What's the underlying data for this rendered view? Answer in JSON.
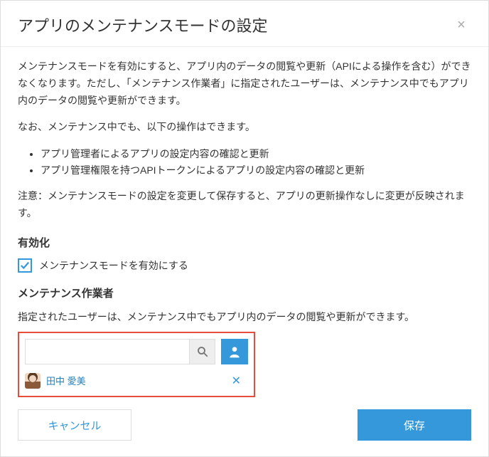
{
  "header": {
    "title": "アプリのメンテナンスモードの設定"
  },
  "body": {
    "para1": "メンテナンスモードを有効にすると、アプリ内のデータの閲覧や更新（APIによる操作を含む）ができなくなります。ただし、「メンテナンス作業者」に指定されたユーザーは、メンテナンス中でもアプリ内のデータの閲覧や更新ができます。",
    "para2": "なお、メンテナンス中でも、以下の操作はできます。",
    "bullets": [
      "アプリ管理者によるアプリの設定内容の確認と更新",
      "アプリ管理権限を持つAPIトークンによるアプリの設定内容の確認と更新"
    ],
    "para3": "注意：メンテナンスモードの設定を変更して保存すると、アプリの更新操作なしに変更が反映されます。"
  },
  "enable": {
    "heading": "有効化",
    "checkbox_label": "メンテナンスモードを有効にする",
    "checked": true
  },
  "workers": {
    "heading": "メンテナンス作業者",
    "description": "指定されたユーザーは、メンテナンス中でもアプリ内のデータの閲覧や更新ができます。",
    "search_value": "",
    "users": [
      {
        "name": "田中 愛美"
      }
    ]
  },
  "footer": {
    "cancel": "キャンセル",
    "save": "保存"
  }
}
